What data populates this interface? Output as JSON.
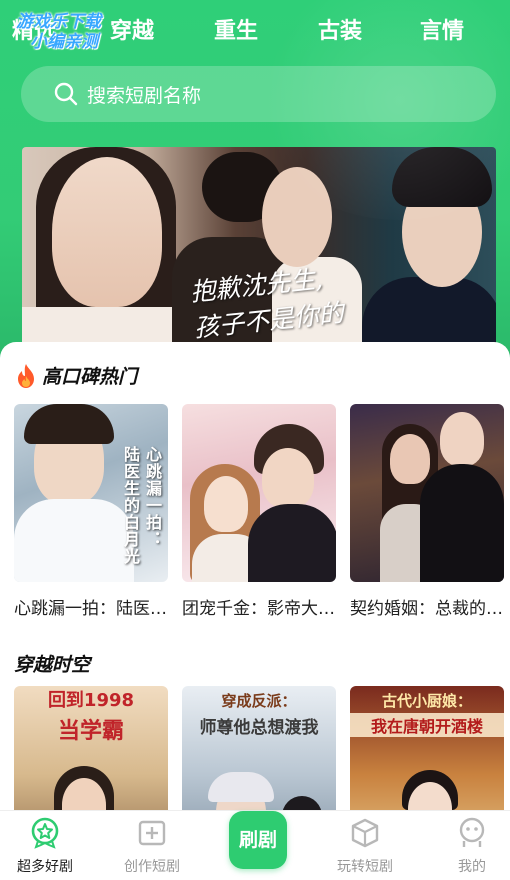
{
  "watermark": {
    "line1": "游戏乐下载",
    "line2": "小编亲测"
  },
  "top_tabs": [
    "精选",
    "穿越",
    "重生",
    "古装",
    "言情"
  ],
  "search": {
    "placeholder": "搜索短剧名称"
  },
  "banner": {
    "caption_line1": "抱歉沈先生,",
    "caption_line2": "孩子不是你的"
  },
  "sections": [
    {
      "title": "高口碑热门",
      "icon": "fire-icon",
      "items": [
        {
          "title": "心跳漏一拍：陆医生的白月光",
          "poster_text_1": "心跳漏一拍：",
          "poster_text_2": "陆医生的白月光"
        },
        {
          "title": "团宠千金：影帝大佬宠上天",
          "poster_text_1": "",
          "poster_text_2": ""
        },
        {
          "title": "契约婚姻：总裁的替身新娘",
          "poster_text_1": "",
          "poster_text_2": ""
        }
      ]
    },
    {
      "title": "穿越时空",
      "icon": "",
      "items": [
        {
          "title": "",
          "poster_top": "回到1998",
          "poster_sub": "当学霸"
        },
        {
          "title": "",
          "poster_top": "穿成反派：",
          "poster_sub": "师尊他总想渡我"
        },
        {
          "title": "",
          "poster_top": "古代小厨娘：",
          "poster_sub": "我在唐朝开酒楼"
        }
      ]
    }
  ],
  "tabbar": [
    {
      "label": "超多好剧",
      "icon": "badge-star-icon",
      "active": true
    },
    {
      "label": "创作短剧",
      "icon": "plus-square-icon",
      "active": false
    },
    {
      "label": "刷剧",
      "icon": "",
      "active": false
    },
    {
      "label": "玩转短剧",
      "icon": "cube-icon",
      "active": false
    },
    {
      "label": "我的",
      "icon": "face-icon",
      "active": false
    }
  ],
  "colors": {
    "brand_green": "#2ecc71",
    "top_bg": "#33cc76"
  }
}
